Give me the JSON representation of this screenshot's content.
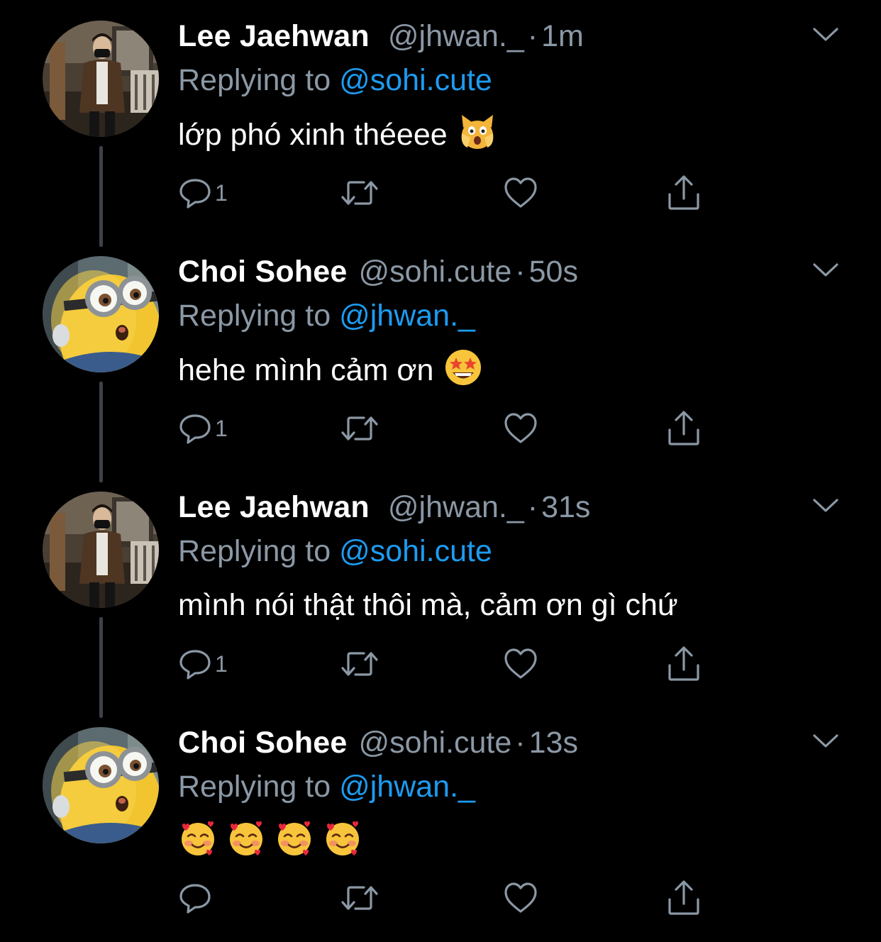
{
  "accent_color": "#1d9bf0",
  "muted_color": "#8b98a5",
  "tweets": [
    {
      "author": "Lee Jaehwan",
      "handle": "@jhwan._",
      "separator": "·",
      "time": "1m",
      "reply_prefix": "Replying to",
      "reply_to": "@sohi.cute",
      "text": "lớp phó xinh théeee",
      "emoji": [
        "screaming-cat-face"
      ],
      "reply_count": "1",
      "avatar": "man-photo-avatar"
    },
    {
      "author": "Choi Sohee",
      "handle": "@sohi.cute",
      "separator": "·",
      "time": "50s",
      "reply_prefix": "Replying to",
      "reply_to": "@jhwan._",
      "text": "hehe mình cảm ơn",
      "emoji": [
        "star-struck-face"
      ],
      "reply_count": "1",
      "avatar": "minion-avatar"
    },
    {
      "author": "Lee Jaehwan",
      "handle": "@jhwan._",
      "separator": "·",
      "time": "31s",
      "reply_prefix": "Replying to",
      "reply_to": "@sohi.cute",
      "text": "mình nói thật thôi mà, cảm ơn gì chứ",
      "emoji": [],
      "reply_count": "1",
      "avatar": "man-photo-avatar"
    },
    {
      "author": "Choi Sohee",
      "handle": "@sohi.cute",
      "separator": "·",
      "time": "13s",
      "reply_prefix": "Replying to",
      "reply_to": "@jhwan._",
      "text": "",
      "emoji": [
        "smiling-face-with-hearts",
        "smiling-face-with-hearts",
        "smiling-face-with-hearts",
        "smiling-face-with-hearts"
      ],
      "reply_count": "",
      "avatar": "minion-avatar"
    }
  ]
}
